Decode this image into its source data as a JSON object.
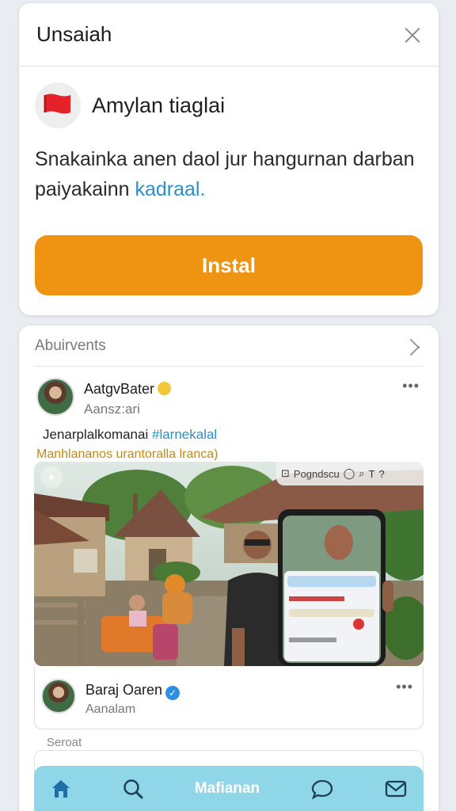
{
  "install_card": {
    "title": "Unsaiah",
    "app_name": "Amylan tiaglai",
    "app_icon": "red-flag-icon",
    "description_line1": "Snakainka anen daol jur hangurnan darban",
    "description_line2": "paiyakainn",
    "description_link": "kadraal.",
    "install_label": "Instal",
    "accent_color": "#ee9412",
    "link_color": "#2d8fc9"
  },
  "feed_card": {
    "title": "Abuirvents",
    "post": {
      "author": "AatgvBater",
      "handle": "Aansz:ari",
      "more": "•••",
      "text_plain": "Jenarplalkomanai",
      "hashtag": "#larnekalal",
      "subtext": "Manhlananos urantoralla lranca)"
    },
    "photo_toolbar": {
      "label": "Pogndscu",
      "icons": [
        "image-icon",
        "chat-icon",
        "search-icon",
        "text-icon",
        "help-icon"
      ]
    },
    "embed": {
      "name": "Baraj Oaren",
      "handle": "Aanalam",
      "more": "•••"
    },
    "section_label": "Seroat"
  },
  "bottom_nav": {
    "items": [
      {
        "icon": "home-icon"
      },
      {
        "icon": "search-icon"
      },
      {
        "label": "Mafianan"
      },
      {
        "icon": "chat-bubble-icon"
      },
      {
        "icon": "mail-icon"
      }
    ],
    "background": "#8fd6e8",
    "icon_color": "#1e6fa8"
  }
}
